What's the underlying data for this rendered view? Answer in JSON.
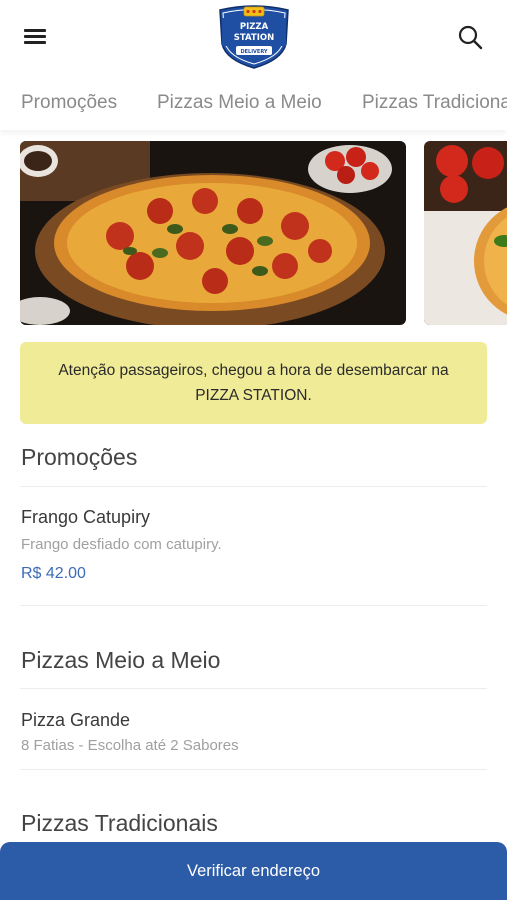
{
  "header": {
    "logo_text": [
      "PIZZA",
      "STATION",
      "DELIVERY"
    ],
    "menu_icon": "hamburger-menu-icon",
    "search_icon": "search-icon"
  },
  "tabs": [
    {
      "label": "Promoções"
    },
    {
      "label": "Pizzas Meio a Meio"
    },
    {
      "label": "Pizzas Tradicionais"
    }
  ],
  "notice": {
    "text": "Atenção passageiros, chegou a hora de desembarcar na PIZZA STATION."
  },
  "sections": [
    {
      "title": "Promoções",
      "items": [
        {
          "name": "Frango Catupiry",
          "description": "Frango desfiado com catupiry.",
          "price": "R$ 42.00"
        }
      ]
    },
    {
      "title": "Pizzas Meio a Meio",
      "items": [
        {
          "name": "Pizza Grande",
          "description": "8 Fatias - Escolha até 2 Sabores"
        }
      ]
    },
    {
      "title": "Pizzas Tradicionais",
      "items": []
    }
  ],
  "bottom_button": {
    "label": "Verificar endereço"
  },
  "colors": {
    "brand_blue": "#2c5ba8",
    "price_blue": "#3d6cb5",
    "notice_yellow": "#f0eb97"
  }
}
